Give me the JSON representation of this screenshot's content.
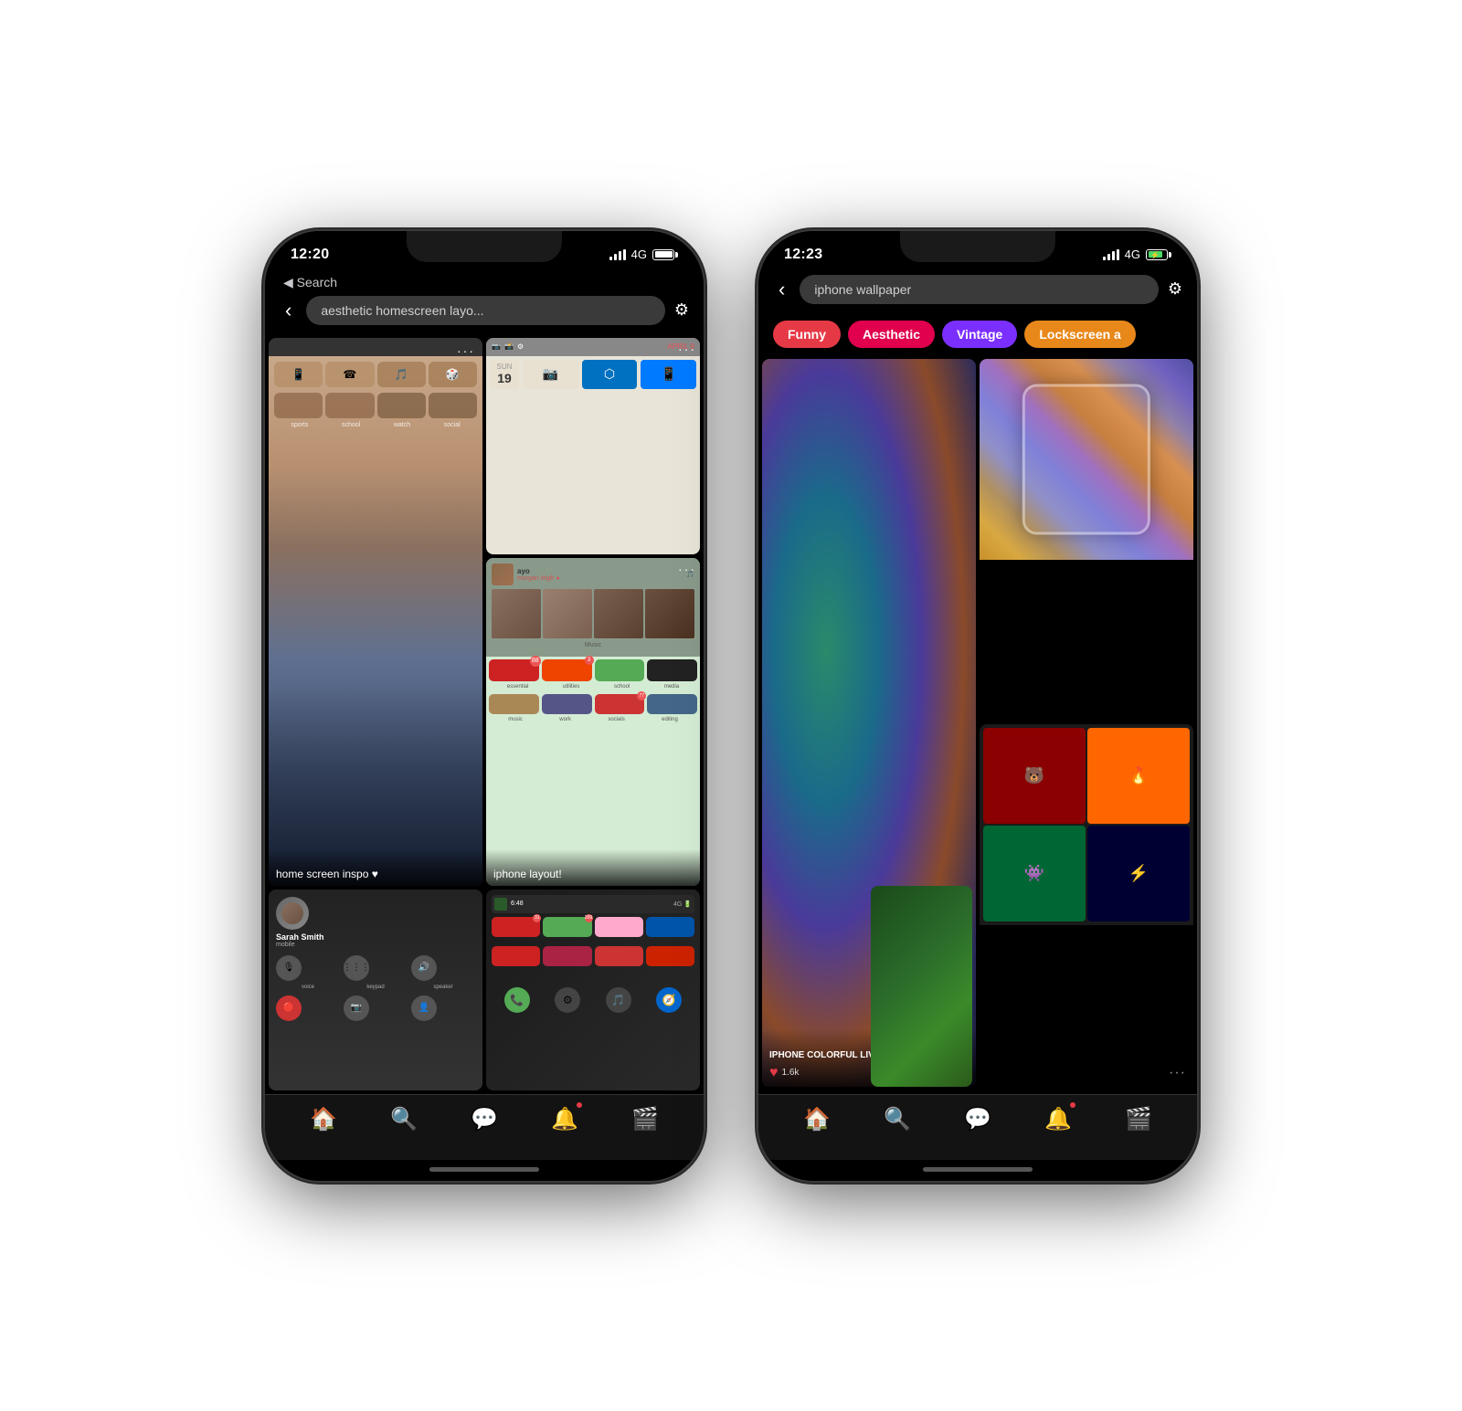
{
  "phones": [
    {
      "id": "phone1",
      "status": {
        "time": "12:20",
        "signal": "4G",
        "battery": 100
      },
      "header": {
        "back_label": "◀ Search",
        "search_text": "aesthetic homescreen layo...",
        "filter_icon": "⚙"
      },
      "pins": [
        {
          "id": "homescreen-inspo",
          "label": "home screen inspo ♥",
          "type": "tall",
          "bg": "homescreen"
        },
        {
          "id": "april-layout",
          "label": "",
          "type": "normal",
          "bg": "widgets"
        },
        {
          "id": "iphone-layout",
          "label": "iphone layout!",
          "type": "normal",
          "bg": "music"
        },
        {
          "id": "call-screen",
          "label": "",
          "type": "normal",
          "bg": "call"
        },
        {
          "id": "more-layout",
          "label": "",
          "type": "normal",
          "bg": "apps"
        }
      ],
      "nav": {
        "items": [
          "🏠",
          "🔍",
          "💬",
          "🔔",
          "🎬"
        ]
      }
    },
    {
      "id": "phone2",
      "status": {
        "time": "12:23",
        "signal": "4G",
        "battery": 80,
        "charging": true
      },
      "header": {
        "search_text": "iphone wallpaper",
        "filter_icon": "⚙"
      },
      "tags": [
        {
          "label": "Funny",
          "color": "red"
        },
        {
          "label": "Aesthetic",
          "color": "pink"
        },
        {
          "label": "Vintage",
          "color": "purple"
        },
        {
          "label": "Lockscreen a",
          "color": "orange"
        }
      ],
      "wallpapers": [
        {
          "id": "colorful-live",
          "title": "IPHONE COLORFUL LIVE WALLPAPER",
          "likes": "1.6k",
          "type": "tall"
        },
        {
          "id": "marble",
          "title": "",
          "likes": "",
          "type": "tall"
        },
        {
          "id": "stickers",
          "title": "",
          "likes": "",
          "type": "normal"
        },
        {
          "id": "tropical",
          "title": "",
          "likes": "",
          "type": "normal"
        }
      ],
      "nav": {
        "items": [
          "🏠",
          "🔍",
          "💬",
          "🔔",
          "🎬"
        ]
      }
    }
  ]
}
